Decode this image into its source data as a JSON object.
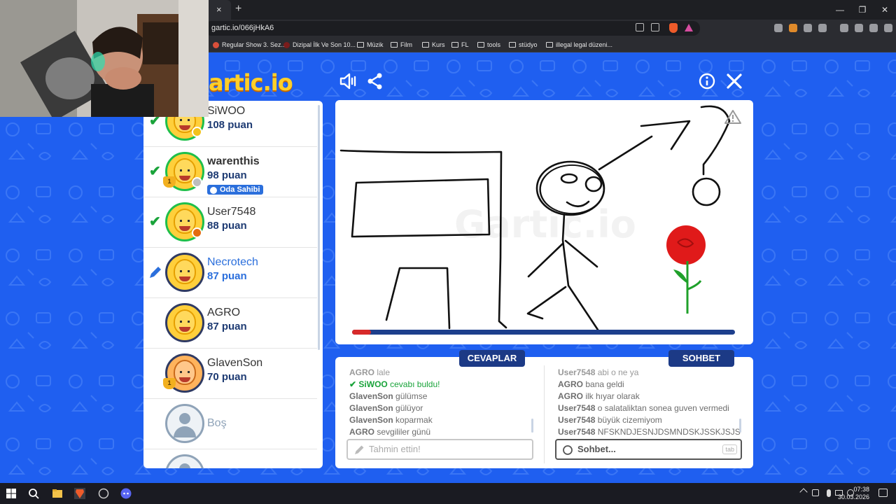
{
  "browser": {
    "url": "gartic.io/066jHkA6",
    "tab_close": "×",
    "new_tab": "+",
    "win_minimize": "—",
    "win_restore": "❐",
    "win_close": "✕",
    "bookmarks": [
      "Regular Show 3. Sez...",
      "Dizipal İlk Ve Son 10...",
      "Müzik",
      "Film",
      "Kurs",
      "FL",
      "tools",
      "stüdyo",
      "illegal legal düzeni..."
    ]
  },
  "game": {
    "logo": "artic.io",
    "players": [
      {
        "name": "SiWOO",
        "points": "108 puan",
        "guessed": true,
        "status_color": "#f3c21a"
      },
      {
        "name": "warenthis",
        "points": "98 puan",
        "guessed": true,
        "status_color": "#bdbdbd",
        "trophy": "1",
        "badge": "Oda Sahibi"
      },
      {
        "name": "User7548",
        "points": "88 puan",
        "guessed": true,
        "status_color": "#e36b10"
      },
      {
        "name": "Necrotech",
        "points": "87 puan",
        "drawing": true
      },
      {
        "name": "AGRO",
        "points": "87 puan"
      },
      {
        "name": "GlavenSon",
        "points": "70 puan",
        "trophy": "1"
      },
      {
        "name": "Boş",
        "empty": true
      }
    ],
    "timer_progress": 0.05,
    "answers_label": "CEVAPLAR",
    "chat_label": "SOHBET",
    "answers": [
      {
        "user": "AGRO",
        "text": "lale"
      },
      {
        "user": "SiWOO",
        "text": "cevabı buldu!",
        "correct": true
      },
      {
        "user": "GlavenSon",
        "text": "gülümse"
      },
      {
        "user": "GlavenSon",
        "text": "gülüyor"
      },
      {
        "user": "GlavenSon",
        "text": "koparmak"
      },
      {
        "user": "AGRO",
        "text": "sevgililer günü"
      }
    ],
    "chat": [
      {
        "user": "User7548",
        "text": "abi o ne ya"
      },
      {
        "user": "AGRO",
        "text": "bana geldi"
      },
      {
        "user": "AGRO",
        "text": "ilk hıyar olarak"
      },
      {
        "user": "User7548",
        "text": "o salataliktan sonea guven vermedi"
      },
      {
        "user": "User7548",
        "text": "büyük cizemiyom"
      },
      {
        "user": "User7548",
        "text": "NFSKNDJESNJDSMNDSKJSSKJSJS"
      }
    ],
    "guess_placeholder": "Tahmin ettin!",
    "chat_placeholder": "Sohbet...",
    "tab_key": "tab"
  },
  "taskbar": {
    "time": "07:38",
    "date": "30.03.2026"
  },
  "colors": {
    "game_bg": "#1f5ff0",
    "panel_label": "#1c3a86",
    "correct": "#19a33a",
    "drawer": "#2b6fdc",
    "timer": "#d72a2a"
  }
}
